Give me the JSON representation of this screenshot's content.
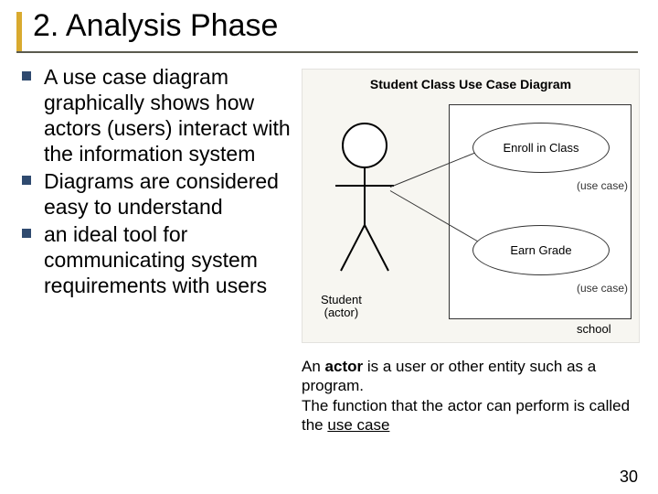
{
  "title": "2. Analysis Phase",
  "bullets": [
    "A use case diagram graphically shows how actors (users) interact with the information system",
    "Diagrams are considered easy to understand",
    "an ideal tool for communicating system requirements with users"
  ],
  "diagram": {
    "title": "Student Class Use Case Diagram",
    "actor_name": "Student",
    "actor_role": "(actor)",
    "container_label": "school",
    "usecases": [
      "Enroll in Class",
      "Earn Grade"
    ],
    "usecase_tag": "(use case)"
  },
  "caption": {
    "line1_pre": "An ",
    "line1_bold": "actor",
    "line1_post": " is a user or other entity such as a program.",
    "line2_pre": "The function that the actor can perform is called the ",
    "line2_underline": "use case"
  },
  "page_number": "30"
}
